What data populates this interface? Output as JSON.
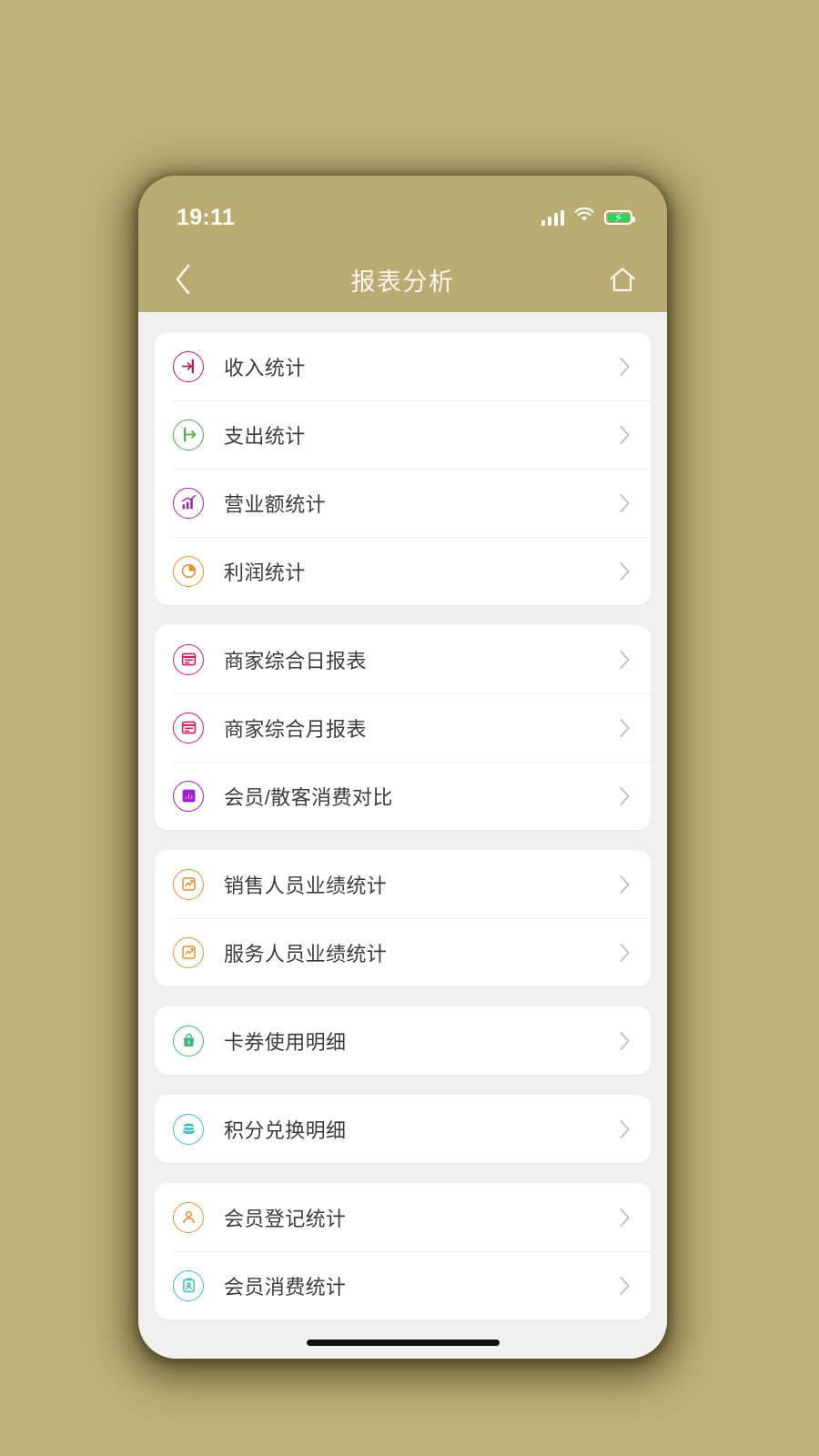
{
  "background_color": "#BFB077",
  "status_bar": {
    "time": "19:11",
    "signal_icon": "cellular-signal-icon",
    "wifi_icon": "wifi-icon",
    "battery_icon": "battery-charging-icon",
    "battery_color": "#31D158"
  },
  "nav": {
    "title": "报表分析",
    "back_icon": "chevron-left-icon",
    "home_icon": "house-icon",
    "bar_color": "#B9AB72",
    "title_color": "#FAF7EC"
  },
  "content_background": "#F0F0F0",
  "groups": [
    {
      "items": [
        {
          "label": "收入统计",
          "icon": "arrow-into-box-icon",
          "color": "#C2185B"
        },
        {
          "label": "支出统计",
          "icon": "arrow-out-of-box-icon",
          "color": "#4CAF50"
        },
        {
          "label": "营业额统计",
          "icon": "bar-chart-up-icon",
          "color": "#9C27B0"
        },
        {
          "label": "利润统计",
          "icon": "pie-chart-icon",
          "color": "#E8912E"
        }
      ]
    },
    {
      "items": [
        {
          "label": "商家综合日报表",
          "icon": "report-window-icon",
          "color": "#D81B60"
        },
        {
          "label": "商家综合月报表",
          "icon": "report-window-icon",
          "color": "#D81B60"
        },
        {
          "label": "会员/散客消费对比",
          "icon": "compare-bars-icon",
          "color": "#A020D0"
        }
      ]
    },
    {
      "items": [
        {
          "label": "销售人员业绩统计",
          "icon": "performance-chart-icon",
          "color": "#E8912E"
        },
        {
          "label": "服务人员业绩统计",
          "icon": "performance-chart-icon",
          "color": "#E8912E"
        }
      ]
    },
    {
      "items": [
        {
          "label": "卡券使用明细",
          "icon": "coupon-bag-icon",
          "color": "#3FB97A"
        }
      ]
    },
    {
      "items": [
        {
          "label": "积分兑换明细",
          "icon": "coins-stack-icon",
          "color": "#3BBFC0"
        }
      ]
    },
    {
      "items": [
        {
          "label": "会员登记统计",
          "icon": "user-register-icon",
          "color": "#E8912E"
        },
        {
          "label": "会员消费统计",
          "icon": "clipboard-member-icon",
          "color": "#3BBFC0"
        }
      ]
    }
  ],
  "home_indicator": "home-indicator-bar"
}
